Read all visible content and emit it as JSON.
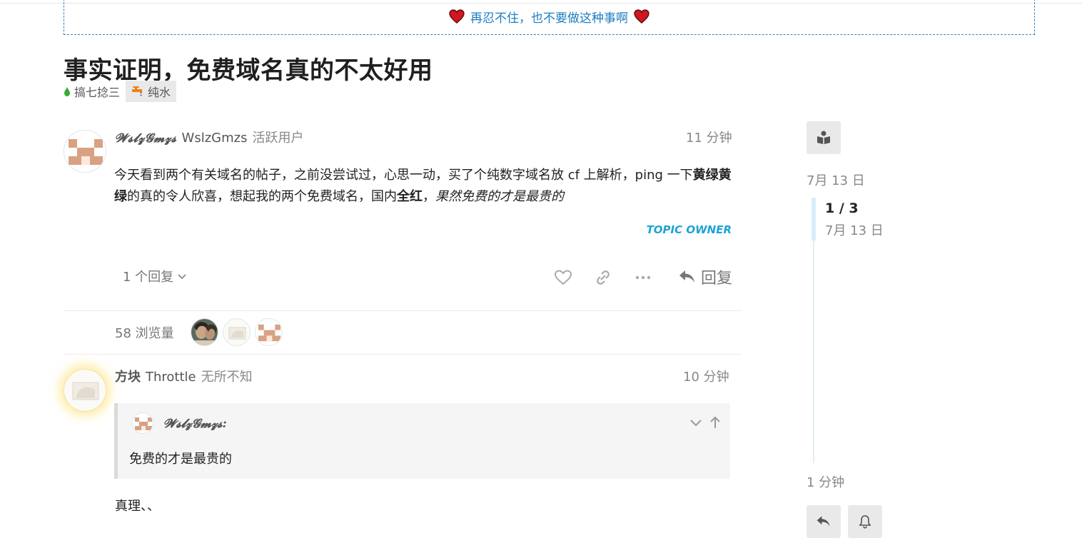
{
  "banner": {
    "text": "再忍不住，也不要做这种事啊"
  },
  "topic": {
    "title": "事实证明，免费域名真的不太好用",
    "category": "搞七捻三",
    "tag": "纯水"
  },
  "post1": {
    "display_name": "𝓦𝓼𝓵𝔃𝓖𝓶𝔃𝓼",
    "username": "WslzGmzs",
    "user_title": "活跃用户",
    "time": "11 分钟",
    "body_p1": "今天看到两个有关域名的帖子，之前没尝试过，心思一动，买了个纯数字域名放 cf 上解析，ping 一下",
    "body_b1": "黄绿黄绿",
    "body_p2": "的真的令人欣喜，想起我的两个免费域名，国内",
    "body_b2": "全红",
    "body_p3": "，",
    "body_i": "果然免费的才是最贵的",
    "owner_badge": "TOPIC OWNER",
    "replies_label": "1 个回复",
    "reply_label": "回复",
    "views_label": "58 浏览量"
  },
  "post2": {
    "display_name": "方块",
    "username": "Throttle",
    "user_title": "无所不知",
    "time": "10 分钟",
    "quote_author": "𝓦𝓼𝓵𝔃𝓖𝓶𝔃𝓼:",
    "quote_text": "免费的才是最贵的",
    "body": "真理、、"
  },
  "timeline": {
    "start_date": "7月 13 日",
    "position": "1 / 3",
    "position_date": "7月 13 日",
    "end_time": "1 分钟"
  },
  "icons": {
    "banner": "heart-icon",
    "category": "drop-icon",
    "tag": "faucet-icon",
    "sidebar_top": "book-reader-icon",
    "sidebar_reply": "reply-icon",
    "sidebar_notify": "bell-icon"
  },
  "colors": {
    "accent": "#1f7dc1",
    "owner_badge": "#1ea3d6",
    "heart": "#d0181e",
    "drop": "#3aaa35"
  }
}
